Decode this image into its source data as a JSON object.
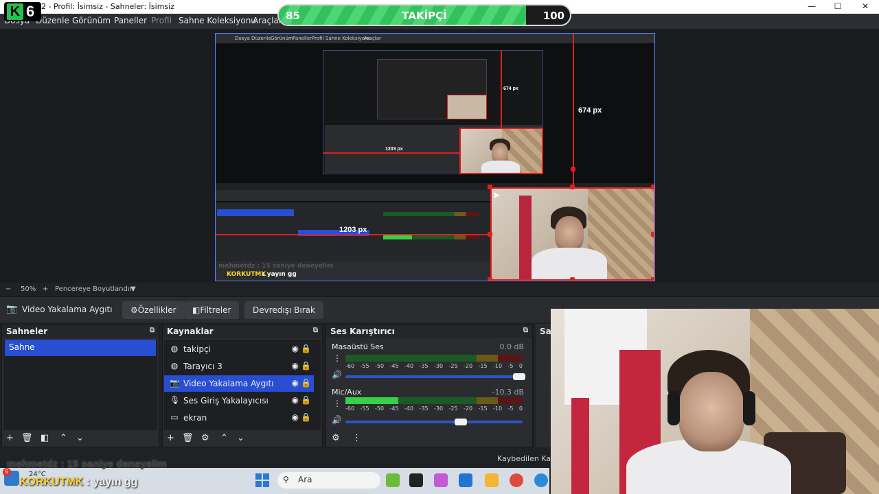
{
  "window": {
    "title": "2 - Profil: İsimsiz - Sahneler: İsimsiz",
    "controls": [
      "—",
      "☐",
      "✕"
    ]
  },
  "logo": {
    "letter": "K",
    "number": "6"
  },
  "follower_bar": {
    "left_value": "85",
    "label": "TAKİPÇİ",
    "right_value": "100",
    "progress_fraction": 0.85,
    "fill_color": "#31c25a"
  },
  "menu": {
    "items": [
      {
        "label": "Dosya"
      },
      {
        "label": "Düzenle"
      },
      {
        "label": "Görünüm"
      },
      {
        "label": "Paneller"
      },
      {
        "label": "Profil",
        "disabled": true
      },
      {
        "label": "Sahne Koleksiyonu"
      },
      {
        "label": "Araçlar"
      }
    ]
  },
  "preview": {
    "height_label": "674 px",
    "width_label": "1203 px",
    "nested": {
      "menu_items": [
        "Dosya",
        "Düzenle",
        "Görünüm",
        "Paneller",
        "Profil",
        "Sahne Koleksiyonu",
        "Araçlar"
      ],
      "height_label": "674 px",
      "width_label": "1203 px",
      "chat1": "mehmetdz : 15 saniye deneyelim",
      "chat2_user": "KORKUTMK",
      "chat2_msg": " : yayın gg"
    }
  },
  "zoom": {
    "minus": "−",
    "value": "50%",
    "plus": "+",
    "fit_label": "Pencereye Boyutlandır",
    "dropdown": "▼"
  },
  "source_toolbar": {
    "source_name": "Video Yakalama Aygıtı",
    "properties": "Özellikler",
    "filters": "Filtreler",
    "deactivate": "Devredışı Bırak"
  },
  "scenes": {
    "title": "Sahneler",
    "items": [
      {
        "label": "Sahne",
        "active": true
      }
    ]
  },
  "sources": {
    "title": "Kaynaklar",
    "items": [
      {
        "label": "takipçi",
        "icon": "browser-icon"
      },
      {
        "label": "Tarayıcı 3",
        "icon": "browser-icon"
      },
      {
        "label": "Video Yakalama Aygıtı",
        "icon": "camera-icon",
        "active": true
      },
      {
        "label": "Ses Giriş Yakalayıcısı",
        "icon": "microphone-icon"
      },
      {
        "label": "ekran",
        "icon": "display-icon"
      }
    ]
  },
  "mixer": {
    "title": "Ses Karıştırıcı",
    "ticks": [
      "-60",
      "-55",
      "-50",
      "-45",
      "-40",
      "-35",
      "-30",
      "-25",
      "-20",
      "-15",
      "-10",
      "-5",
      "0"
    ],
    "channels": [
      {
        "name": "Masaüstü Ses",
        "db": "0.0 dB",
        "level_fraction": 0.0,
        "fader_fraction": 0.98
      },
      {
        "name": "Mic/Aux",
        "db": "-10.3 dB",
        "level_fraction": 0.3,
        "fader_fraction": 0.65
      }
    ]
  },
  "partial_dock": {
    "title": "Sa"
  },
  "status": {
    "dropped": "Kaybedilen Kare"
  },
  "chat": {
    "line1": "mehmetdz : 15 saniye deneyelim",
    "line2_user": "KORKUTMK",
    "line2_msg": " : yayın gg"
  },
  "taskbar": {
    "weather_badge": "6",
    "temperature": "24°C",
    "search_placeholder": "Ara"
  }
}
